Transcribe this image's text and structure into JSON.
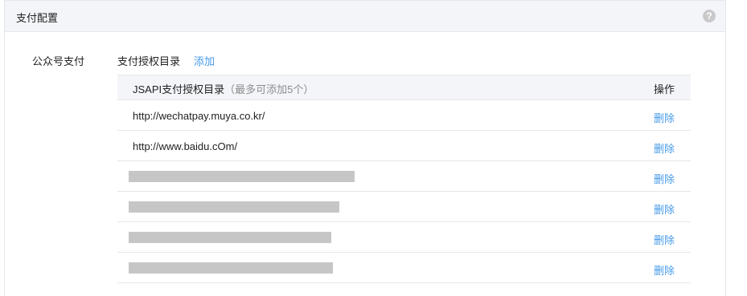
{
  "panel": {
    "title": "支付配置",
    "help_icon": "?"
  },
  "config": {
    "row_label": "公众号支付",
    "dir_title": "支付授权目录",
    "add_label": "添加"
  },
  "table": {
    "header_main": "JSAPI支付授权目录",
    "header_note": "（最多可添加5个）",
    "header_op": "操作",
    "rows": [
      {
        "url": "http://wechatpay.muya.co.kr/",
        "action": "删除"
      },
      {
        "url": "http://www.baidu.cOm/",
        "action": "删除"
      },
      {
        "url": "",
        "action": "删除"
      },
      {
        "url": "",
        "action": "删除"
      },
      {
        "url": "",
        "action": "删除"
      },
      {
        "url": "",
        "action": "删除"
      }
    ]
  }
}
